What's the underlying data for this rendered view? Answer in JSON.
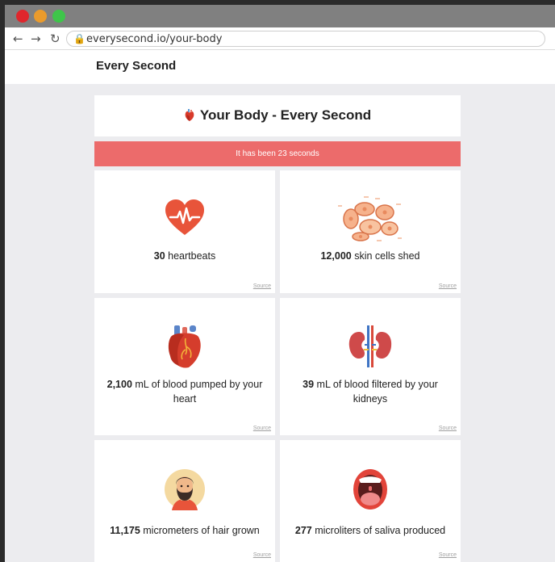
{
  "browser": {
    "back": "←",
    "forward": "→",
    "reload": "↻",
    "url": "everysecond.io/your-body"
  },
  "site": {
    "title": "Every Second"
  },
  "hero": {
    "title": "Your Body - Every Second"
  },
  "banner": {
    "text": "It has been 23 seconds"
  },
  "cards": [
    {
      "value": "30",
      "text": "heartbeats",
      "source": "Source",
      "icon": "heartbeat-icon"
    },
    {
      "value": "12,000",
      "text": "skin cells shed",
      "source": "Source",
      "icon": "skin-cells-icon"
    },
    {
      "value": "2,100",
      "text": "mL of blood pumped by your heart",
      "source": "Source",
      "icon": "anatomical-heart-icon"
    },
    {
      "value": "39",
      "text": "mL of blood filtered by your kidneys",
      "source": "Source",
      "icon": "kidneys-icon"
    },
    {
      "value": "11,175",
      "text": "micrometers of hair grown",
      "source": "Source",
      "icon": "bearded-man-icon"
    },
    {
      "value": "277",
      "text": "microliters of saliva produced",
      "source": "Source",
      "icon": "open-mouth-icon"
    }
  ],
  "colors": {
    "banner": "#ec6b6b",
    "page_background": "#ececef",
    "close_dot": "#e0262c",
    "minimize_dot": "#ea9b2c",
    "maximize_dot": "#3ec54a"
  }
}
